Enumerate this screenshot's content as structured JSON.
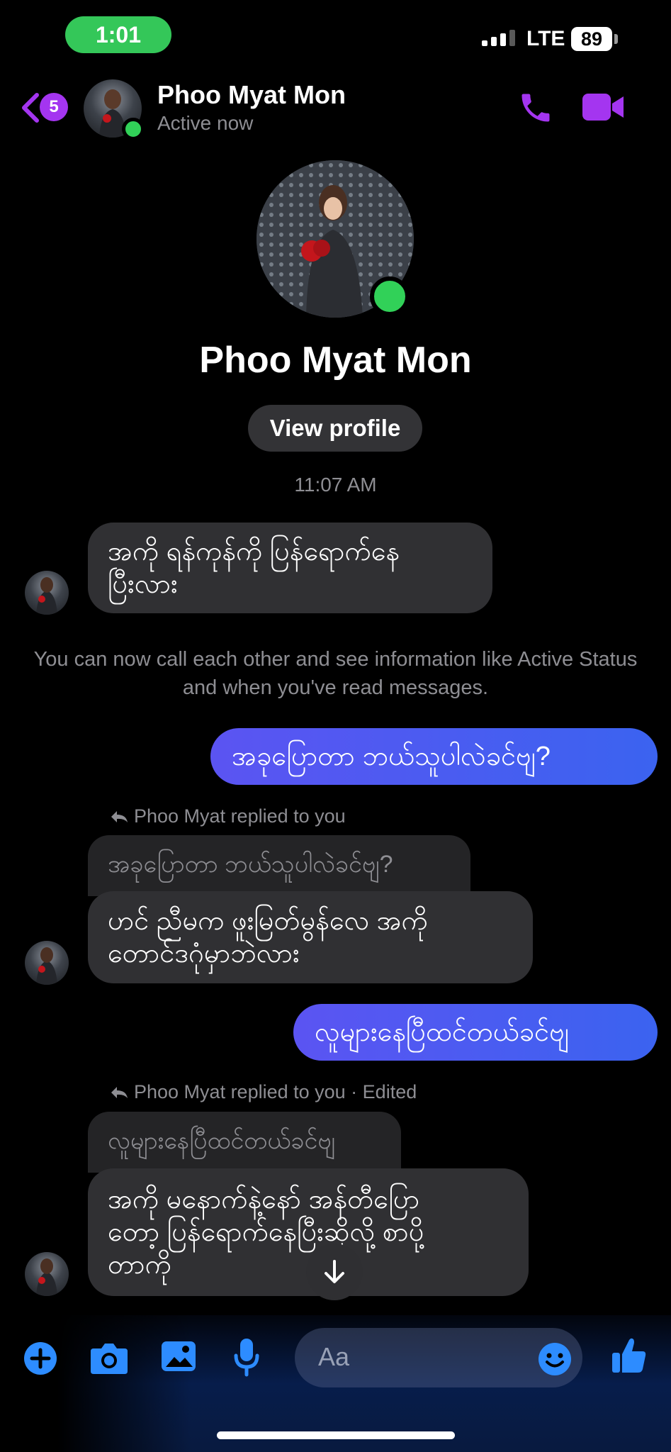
{
  "status_bar": {
    "time": "1:01",
    "network": "LTE",
    "battery": "89"
  },
  "header": {
    "back_badge": "5",
    "contact_name": "Phoo Myat Mon",
    "status": "Active now",
    "icons": [
      "back-chevron-icon",
      "phone-icon",
      "video-camera-icon"
    ],
    "accent_color": "#a435f0"
  },
  "profile": {
    "name": "Phoo Myat Mon",
    "view_profile_label": "View profile"
  },
  "conversation": {
    "timestamp": "11:07 AM",
    "first_incoming": "အကို ရန်ကုန်ကို ပြန်ရောက်နေ\nပြီးလား",
    "system_note": "You can now call each other and see information like Active Status and when you've read messages.",
    "outgoing_1": "အခုပြောတာ ဘယ်သူပါလဲခင်ဗျ?",
    "reply_1": {
      "label": "Phoo Myat replied to you",
      "quoted": "အခုပြောတာ ဘယ်သူပါလဲခင်ဗျ?",
      "message": "ဟင် ညီမက ဖူးမြတ်မွန်လေ အကို\nတောင်ဒဂုံမှာဘဲလား"
    },
    "outgoing_2": "လူများနေပြီထင်တယ်ခင်ဗျ",
    "reply_2": {
      "label": "Phoo Myat replied to you · Edited",
      "quoted": "လူများနေပြီထင်တယ်ခင်ဗျ",
      "message": "အကို မနောက်နဲ့နော် အန်တီပြော\nတော့ ပြန်ရောက်နေပြီးဆိုလို့ စာပို့\nတာကို"
    },
    "outgoing_color": "#4f5cf1"
  },
  "composer": {
    "placeholder": "Aa",
    "icons": [
      "plus-icon",
      "camera-icon",
      "image-icon",
      "microphone-icon",
      "emoji-icon",
      "thumbs-up-icon"
    ],
    "icon_color": "#2d8cff"
  }
}
